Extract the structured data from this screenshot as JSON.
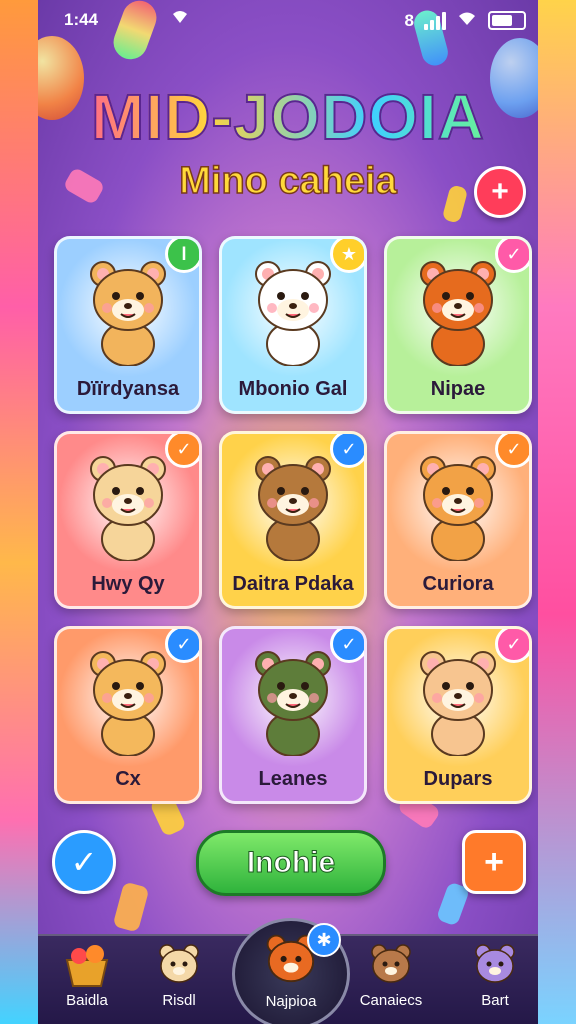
{
  "status": {
    "time": "1:44",
    "signal_text": "8"
  },
  "header": {
    "title": "MID-JODOIA",
    "subtitle": "Mino caheia",
    "add_icon": "plus-icon"
  },
  "colors": {
    "accent": "#8b4fc6",
    "green": "#2fb33c",
    "blue": "#2a9cff",
    "pink": "#ff3fa4"
  },
  "characters": [
    {
      "name": "Dïïrdyansa",
      "badge": "green",
      "badge_icon": "l",
      "bg": "#9ccfff",
      "fur": "#f2b45c"
    },
    {
      "name": "Mbonio Gal",
      "badge": "star",
      "badge_icon": "★",
      "bg": "#9fe4ff",
      "fur": "#ffffff"
    },
    {
      "name": "Nipae",
      "badge": "pink",
      "badge_icon": "✓",
      "bg": "#b7f09a",
      "fur": "#e66b1e"
    },
    {
      "name": "Hwy Qy",
      "badge": "orange",
      "badge_icon": "✓",
      "bg": "#ff8a8a",
      "fur": "#f6d59a"
    },
    {
      "name": "Daitra Pdaka",
      "badge": "blue",
      "badge_icon": "✓",
      "bg": "#ffd24a",
      "fur": "#b5793c"
    },
    {
      "name": "Curiora",
      "badge": "orange",
      "badge_icon": "✓",
      "bg": "#ffb07a",
      "fur": "#f2a246"
    },
    {
      "name": "Cx",
      "badge": "blue",
      "badge_icon": "✓",
      "bg": "#ff9a6a",
      "fur": "#f4b85c"
    },
    {
      "name": "Leanes",
      "badge": "blue",
      "badge_icon": "✓",
      "bg": "#c98ae8",
      "fur": "#5e7d3a"
    },
    {
      "name": "Dupars",
      "badge": "pink",
      "badge_icon": "✓",
      "bg": "#ffcf5a",
      "fur": "#f7c590"
    }
  ],
  "actions": {
    "left_icon": "checkmark-icon",
    "primary_label": "Inohie",
    "right_icon": "plus-icon"
  },
  "tabs": [
    {
      "label": "Baidla",
      "icon": "treasure-basket-icon"
    },
    {
      "label": "Risdl",
      "icon": "party-cat-icon"
    },
    {
      "label": "Najpioa",
      "icon": "fox-icon"
    },
    {
      "label": "Canaiecs",
      "icon": "bear-icon"
    },
    {
      "label": "Bart",
      "icon": "purple-cat-icon"
    }
  ]
}
